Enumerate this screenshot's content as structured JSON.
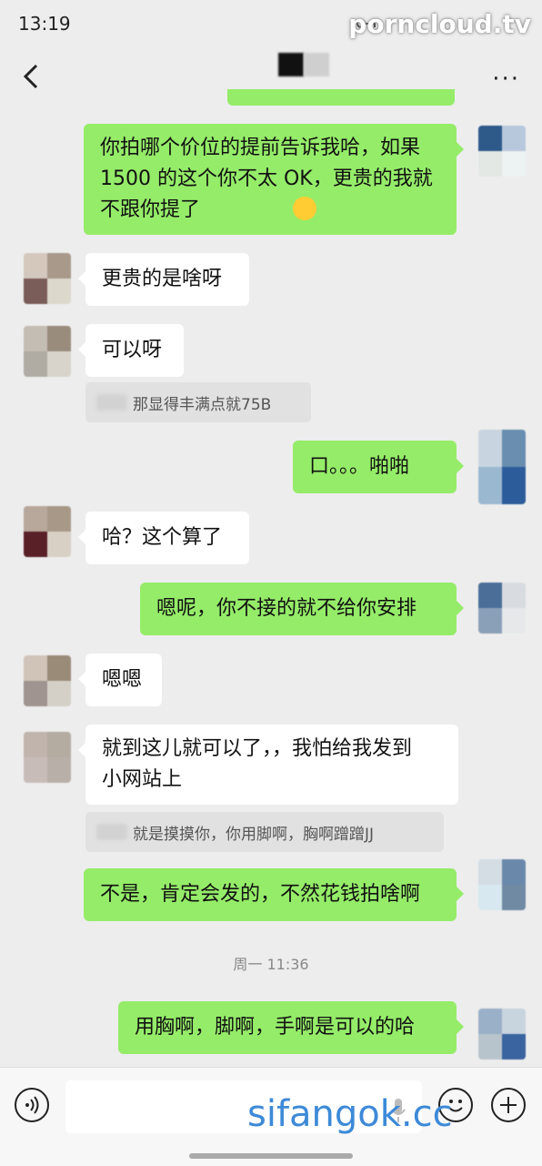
{
  "status": {
    "time": "13:19",
    "watermark_top": "porncloud.tv"
  },
  "nav": {
    "more_label": "···"
  },
  "messages": [
    {
      "side": "me",
      "text": "你拍哪个价位的提前告诉我哈，如果\n1500 的这个你不太 OK，更贵的我就\n不跟你提了",
      "emoji": "grinning-sweat-emoji"
    },
    {
      "side": "them",
      "text": "更贵的是啥呀"
    },
    {
      "side": "them",
      "text": "可以呀"
    },
    {
      "quote": "那显得丰满点就75B"
    },
    {
      "side": "me",
      "text": "口。。。啪啪"
    },
    {
      "side": "them",
      "text": "哈？这个算了"
    },
    {
      "side": "me",
      "text": "嗯呢，你不接的就不给你安排"
    },
    {
      "side": "them",
      "text": "嗯嗯"
    },
    {
      "side": "them",
      "text": "就到这儿就可以了，，我怕给我发到\n小网站上"
    },
    {
      "quote": "就是摸摸你，你用脚啊，胸啊蹭蹭JJ"
    },
    {
      "side": "me",
      "text": "不是，肯定会发的，不然花钱拍啥啊"
    },
    {
      "side": "me",
      "text": "用胸啊，脚啊，手啊是可以的哈"
    }
  ],
  "timestamp": "周一 11:36",
  "bottom": {
    "watermark_bottom": "sifangok.cc"
  },
  "colors": {
    "my_bubble": "#95ec69",
    "their_bubble": "#ffffff",
    "background": "#ededed"
  },
  "icons": [
    "key-icon",
    "back-arrow-icon",
    "more-icon",
    "voice-icon",
    "mic-icon",
    "emoji-icon",
    "plus-icon"
  ]
}
